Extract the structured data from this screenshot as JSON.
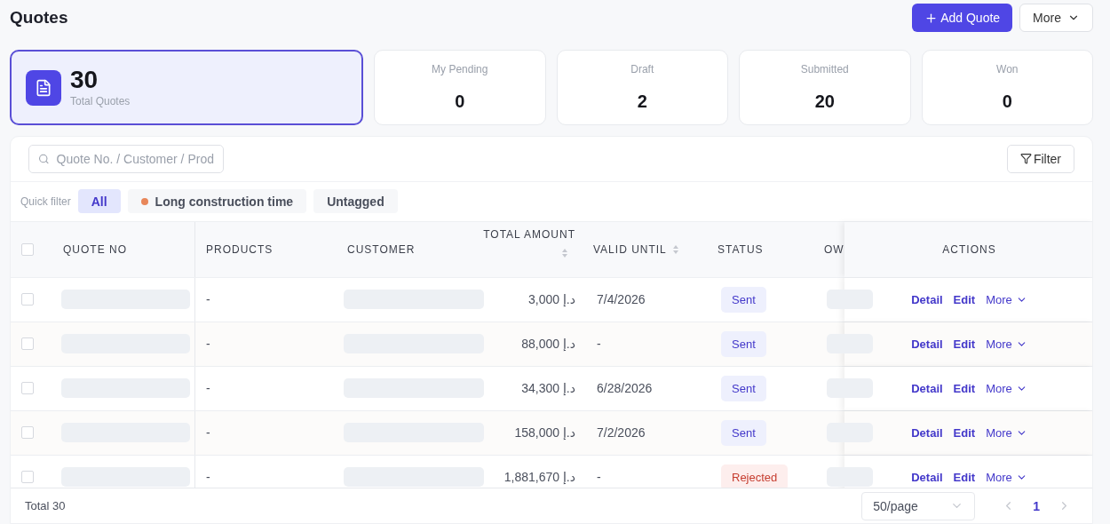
{
  "page": {
    "title": "Quotes"
  },
  "header_buttons": [
    {
      "kind": "primary",
      "label": "Add Quote"
    },
    {
      "kind": "menu",
      "label": "More"
    }
  ],
  "stats": [
    {
      "kind": "total",
      "value": "30",
      "label": "Total Quotes",
      "selected": true
    },
    {
      "kind": "plain",
      "value": "0",
      "label": "My Pending",
      "selected": false
    },
    {
      "kind": "plain",
      "value": "2",
      "label": "Draft",
      "selected": false
    },
    {
      "kind": "plain",
      "value": "20",
      "label": "Submitted",
      "selected": false
    },
    {
      "kind": "plain",
      "value": "0",
      "label": "Won",
      "selected": false
    }
  ],
  "search": {
    "placeholder": "Quote No. / Customer / Prod"
  },
  "filter_button": "Filter",
  "quick_filter": {
    "label": "Quick filter",
    "chips": [
      {
        "label": "All",
        "selected": true
      },
      {
        "label": "Long construction time",
        "selected": false,
        "color": "#e8875a"
      },
      {
        "label": "Untagged",
        "selected": false
      }
    ]
  },
  "table": {
    "select_all_checked": false,
    "columns": [
      "QUOTE NO",
      "PRODUCTS",
      "CUSTOMER",
      "TOTAL AMOUNT",
      "VALID UNTIL",
      "STATUS",
      "OW",
      "ACTIONS"
    ],
    "rows": [
      {
        "checked": false,
        "products": "-",
        "total_amount": "3,000 د.إ",
        "valid_until": "7/4/2026",
        "status": "Sent",
        "kind": "sent",
        "actions": [
          "Detail",
          "Edit",
          "More"
        ]
      },
      {
        "checked": false,
        "products": "-",
        "total_amount": "88,000 د.إ",
        "valid_until": "-",
        "status": "Sent",
        "kind": "sent",
        "actions": [
          "Detail",
          "Edit",
          "More"
        ]
      },
      {
        "checked": false,
        "products": "-",
        "total_amount": "34,300 د.إ",
        "valid_until": "6/28/2026",
        "status": "Sent",
        "kind": "sent",
        "actions": [
          "Detail",
          "Edit",
          "More"
        ]
      },
      {
        "checked": false,
        "products": "-",
        "total_amount": "158,000 د.إ",
        "valid_until": "7/2/2026",
        "status": "Sent",
        "kind": "sent",
        "actions": [
          "Detail",
          "Edit",
          "More"
        ]
      },
      {
        "checked": false,
        "products": "-",
        "total_amount": "1,881,670 د.إ",
        "valid_until": "-",
        "status": "Rejected",
        "kind": "rejected",
        "actions": [
          "Detail",
          "Edit",
          "More"
        ]
      }
    ]
  },
  "footer": {
    "total": "Total 30",
    "page_size": "50/page",
    "pages": [
      {
        "label": "1",
        "selected": true
      }
    ]
  }
}
